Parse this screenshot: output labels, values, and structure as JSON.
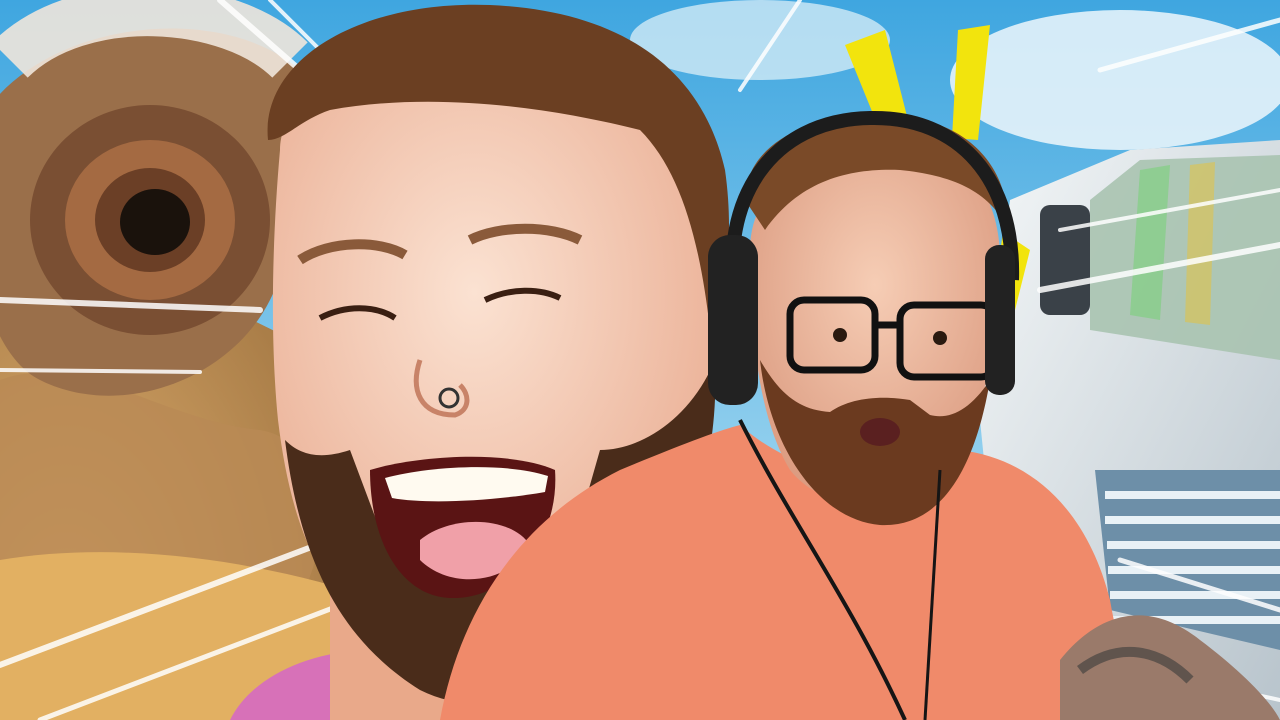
{
  "scene": {
    "kind": "video-thumbnail",
    "subjects": [
      "laughing-man",
      "surprised-man-with-headphones"
    ],
    "background_elements": [
      "sandworm",
      "desert-sand",
      "sky",
      "truck"
    ],
    "effects": [
      "speed-lines",
      "alert-marks"
    ],
    "colors": {
      "sky": "#6fbfe6",
      "sand": "#c99a5a",
      "shirt_coral": "#f08a6a",
      "shirt_pink": "#e07cc0",
      "alert_yellow": "#f2e40d",
      "hair_brown": "#6b3f22",
      "skin": "#f2c2a6"
    }
  }
}
